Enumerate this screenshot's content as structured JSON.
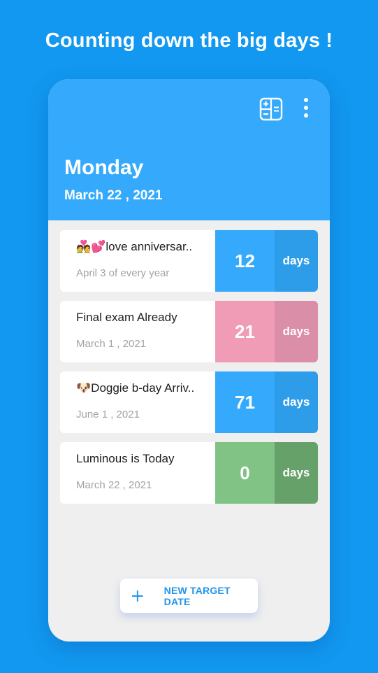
{
  "promo": {
    "headline": "Counting down the big days !"
  },
  "header": {
    "day_name": "Monday",
    "date": "March 22 , 2021",
    "icons": [
      "calculator-icon",
      "more-vert-icon"
    ]
  },
  "events": [
    {
      "title": "💑💕love anniversar..",
      "subtitle": "April 3 of every year",
      "count": "12",
      "unit": "days",
      "color": "#35aafc",
      "unit_color": "#2e9de9"
    },
    {
      "title": "Final exam Already",
      "subtitle": "March 1 , 2021",
      "count": "21",
      "unit": "days",
      "color": "#f09cb7",
      "unit_color": "#db8ea8"
    },
    {
      "title": "🐶Doggie b-day Arriv..",
      "subtitle": "June 1 , 2021",
      "count": "71",
      "unit": "days",
      "color": "#35aafc",
      "unit_color": "#2e9de9"
    },
    {
      "title": "Luminous is Today",
      "subtitle": "March 22 , 2021",
      "count": "0",
      "unit": "days",
      "color": "#80c384",
      "unit_color": "#66a169"
    }
  ],
  "actions": {
    "new_target_label": "NEW TARGET DATE"
  },
  "colors": {
    "background": "#1298f0",
    "header": "#35aafc",
    "body": "#efefef",
    "accent": "#2196e8"
  }
}
